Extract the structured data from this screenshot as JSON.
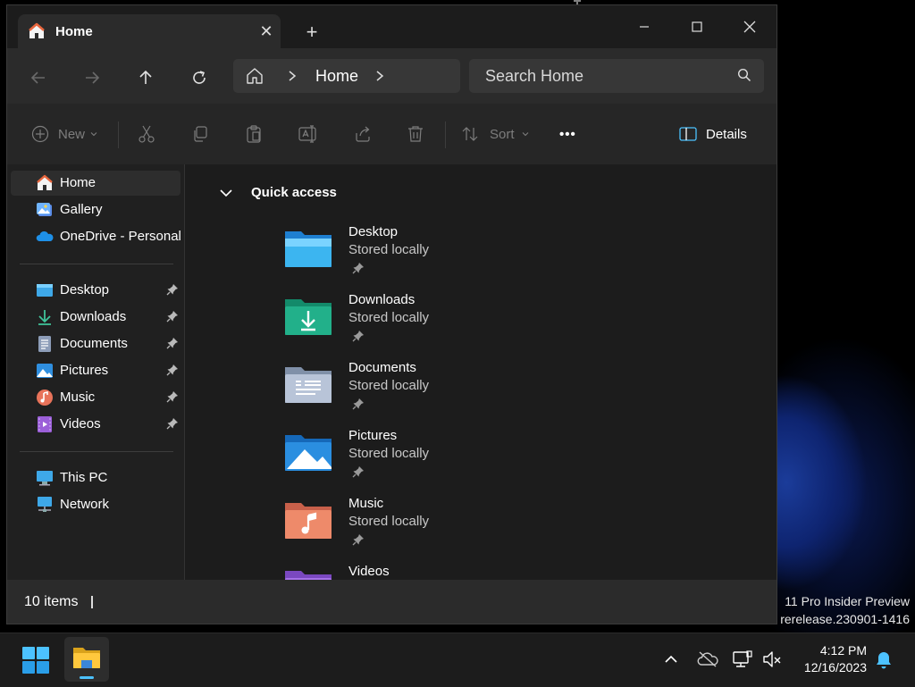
{
  "window": {
    "tab_title": "Home",
    "tab_close": "✕",
    "new_tab": "+"
  },
  "navigation": {
    "address_location": "Home",
    "search_placeholder": "Search Home"
  },
  "toolbar": {
    "new_label": "New",
    "sort_label": "Sort",
    "more_label": "•••",
    "details_label": "Details"
  },
  "sidebar": {
    "items": [
      {
        "label": "Home",
        "icon": "home-icon",
        "selected": true
      },
      {
        "label": "Gallery",
        "icon": "gallery-icon"
      },
      {
        "label": "OneDrive - Personal",
        "icon": "onedrive-icon"
      },
      {
        "label": "Desktop",
        "icon": "desktop-folder-icon",
        "pinned": true
      },
      {
        "label": "Downloads",
        "icon": "downloads-icon",
        "pinned": true
      },
      {
        "label": "Documents",
        "icon": "documents-icon",
        "pinned": true
      },
      {
        "label": "Pictures",
        "icon": "pictures-icon",
        "pinned": true
      },
      {
        "label": "Music",
        "icon": "music-icon",
        "pinned": true
      },
      {
        "label": "Videos",
        "icon": "videos-icon",
        "pinned": true
      },
      {
        "label": "This PC",
        "icon": "this-pc-icon"
      },
      {
        "label": "Network",
        "icon": "network-icon"
      }
    ]
  },
  "main": {
    "section_title": "Quick access",
    "folders": [
      {
        "name": "Desktop",
        "status": "Stored locally",
        "icon": "desktop-folder-icon"
      },
      {
        "name": "Downloads",
        "status": "Stored locally",
        "icon": "downloads-folder-icon"
      },
      {
        "name": "Documents",
        "status": "Stored locally",
        "icon": "documents-folder-icon"
      },
      {
        "name": "Pictures",
        "status": "Stored locally",
        "icon": "pictures-folder-icon"
      },
      {
        "name": "Music",
        "status": "Stored locally",
        "icon": "music-folder-icon"
      },
      {
        "name": "Videos",
        "status": "",
        "icon": "videos-folder-icon"
      }
    ]
  },
  "status_bar": {
    "item_count": "10 items"
  },
  "desktop": {
    "watermark_line1": "11 Pro Insider Preview",
    "watermark_line2": "rerelease.230901-1416"
  },
  "taskbar": {
    "time": "4:12 PM",
    "date": "12/16/2023"
  },
  "colors": {
    "accent": "#4cc2ff",
    "window_bg": "#202020",
    "pane_bg": "#2b2b2b"
  }
}
